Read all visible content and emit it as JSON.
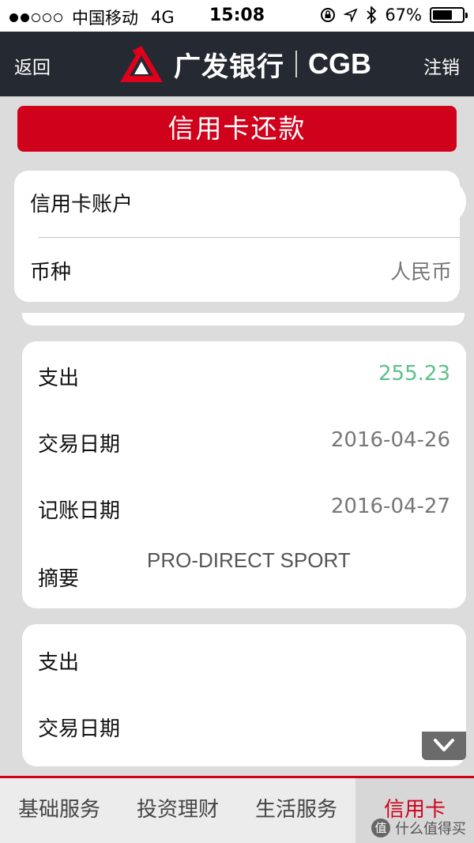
{
  "status_bar": {
    "carrier": "中国移动",
    "network": "4G",
    "time": "15:08",
    "battery": "67%",
    "battery_level": 0.67
  },
  "nav": {
    "back_label": "返回",
    "brand_name": "广发银行",
    "brand_abbr": "CGB",
    "logout_label": "注销"
  },
  "page_title": "信用卡还款",
  "account": {
    "account_label": "信用卡账户",
    "currency_label": "币种",
    "currency_value": "人民币"
  },
  "transactions": [
    {
      "type_label": "支出",
      "amount": "255.23",
      "trade_date_label": "交易日期",
      "trade_date": "2016-04-26",
      "post_date_label": "记账日期",
      "post_date": "2016-04-27",
      "summary_label": "摘要",
      "summary": "PRO-DIRECT SPORT"
    },
    {
      "type_label": "支出",
      "trade_date_label": "交易日期"
    }
  ],
  "tabs": [
    {
      "label": "基础服务",
      "active": false
    },
    {
      "label": "投资理财",
      "active": false
    },
    {
      "label": "生活服务",
      "active": false
    },
    {
      "label": "信用卡",
      "active": true
    }
  ],
  "watermark": {
    "badge": "值",
    "text": "什么值得买"
  },
  "colors": {
    "brand_red": "#d0021b",
    "nav_dark": "#252a32",
    "amount_green": "#5cc08a"
  }
}
